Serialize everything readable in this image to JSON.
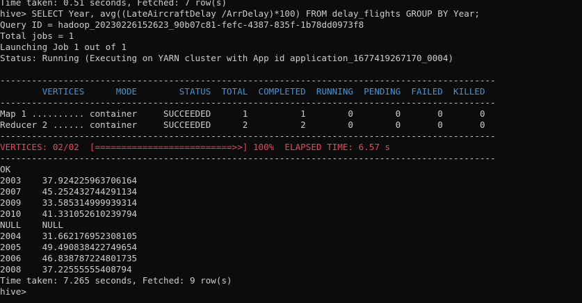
{
  "terminal": {
    "lines": [
      "Time taken: 0.51 seconds, Fetched: 7 row(s)",
      "hive> SELECT Year, avg((LateAircraftDelay /ArrDelay)*100) FROM delay_flights GROUP BY Year;",
      "Query ID = hadoop_20230226152623_90b07c81-fefc-4387-835f-1b78dd0973f8",
      "Total jobs = 1",
      "Launching Job 1 out of 1",
      "Status: Running (Executing on YARN cluster with App id application_1677419267170_0004)",
      "",
      "----------------------------------------------------------------------------------------------",
      "        VERTICES      MODE        STATUS  TOTAL  COMPLETED  RUNNING  PENDING  FAILED  KILLED",
      "----------------------------------------------------------------------------------------------",
      "Map 1 .......... container     SUCCEEDED      1          1        0        0       0       0",
      "Reducer 2 ...... container     SUCCEEDED      2          2        0        0       0       0",
      "----------------------------------------------------------------------------------------------",
      "VERTICES: 02/02  [==========================>>] 100%  ELAPSED TIME: 6.57 s",
      "----------------------------------------------------------------------------------------------",
      "OK",
      "2003    37.924225963706164",
      "2007    45.252432744291134",
      "2009    33.585314999939314",
      "2010    41.331052610239794",
      "NULL    NULL",
      "2004    31.662176952308105",
      "2005    49.490838422749654",
      "2006    46.838787224801735",
      "2008    37.22555555408794",
      "Time taken: 7.265 seconds, Fetched: 9 row(s)",
      "hive>"
    ]
  },
  "colors": {
    "background": "#0c0c0c",
    "text": "#cccccc",
    "header": "#3a96dd",
    "progress": "#e74856"
  }
}
